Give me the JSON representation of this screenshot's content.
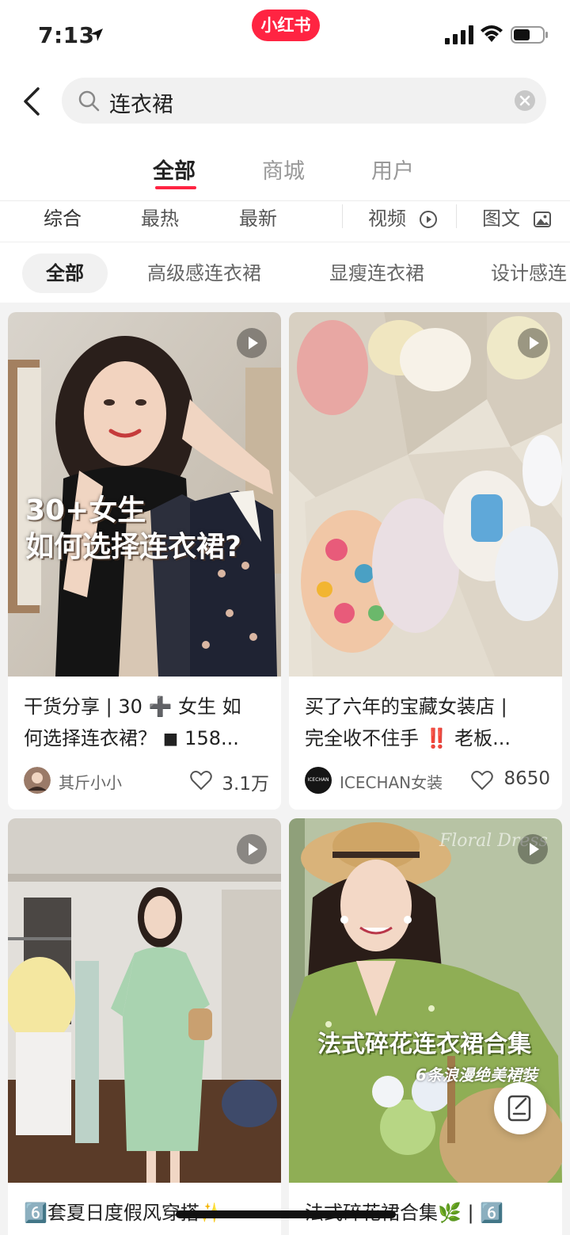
{
  "status": {
    "time": "7:13"
  },
  "brand": {
    "logo_text": "小红书"
  },
  "search": {
    "query": "连衣裙"
  },
  "tabs": [
    {
      "label": "全部",
      "active": true
    },
    {
      "label": "商城",
      "active": false
    },
    {
      "label": "用户",
      "active": false
    }
  ],
  "filters": {
    "sort": [
      "综合",
      "最热",
      "最新"
    ],
    "video": "视频",
    "image_text": "图文"
  },
  "chips": [
    "全部",
    "高级感连衣裙",
    "显瘦连衣裙",
    "设计感连"
  ],
  "cards": [
    {
      "overlay_line1": "30+女生",
      "overlay_line2": "如何选择连衣裙?",
      "title_line1": "干货分享 | 30 ➕ 女生 如",
      "title_line2": "何选择连衣裙？ ◼ 158...",
      "author": "其斤小小",
      "likes": "3.1万"
    },
    {
      "title_line1": "买了六年的宝藏女装店 |",
      "title_line2": "完全收不住手 ‼️ 老板...",
      "author": "ICECHAN女装",
      "avatar_text": "ICECHAN",
      "likes": "8650"
    },
    {
      "title_line1": "6️⃣套夏日度假风穿搭✨"
    },
    {
      "watermark": "Floral Dress",
      "overlay_line1": "法式碎花连衣裙合集",
      "overlay_line2": "6条浪漫绝美裙装",
      "title_line1": "法式碎花裙合集🌿 | 6️⃣"
    }
  ],
  "colors": {
    "accent": "#ff2442",
    "background": "#f3f3f3"
  }
}
